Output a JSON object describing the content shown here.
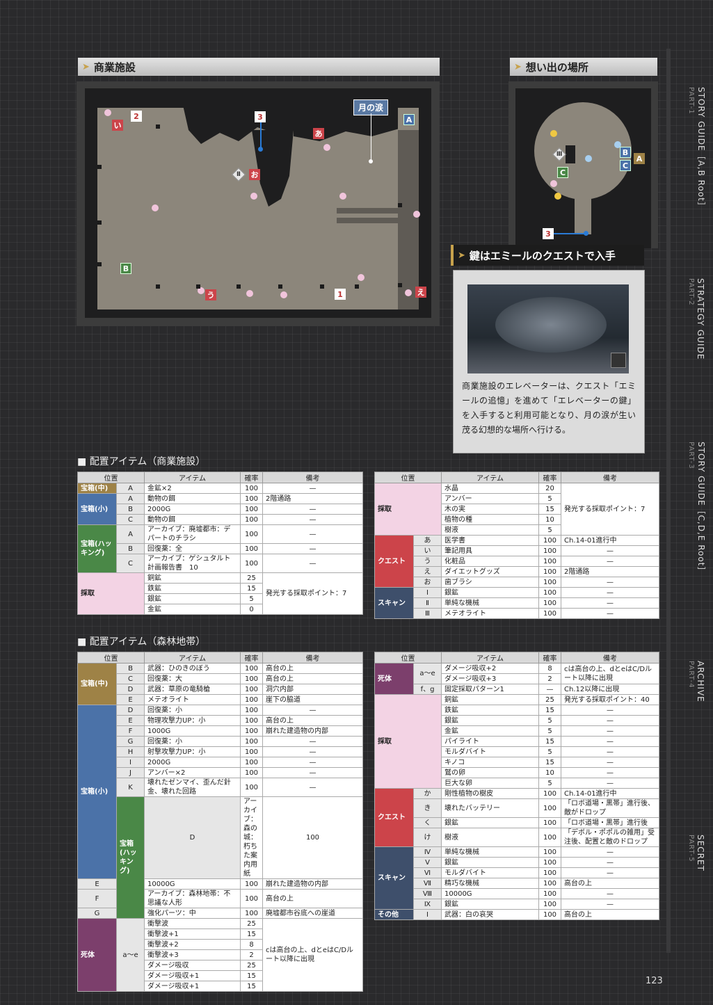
{
  "map1": {
    "title": "商業施設",
    "tag_tears": "月の涙",
    "markers": {
      "i": "い",
      "a": "あ",
      "o": "お",
      "u": "う",
      "e": "え",
      "n1": "1",
      "n2": "2",
      "n3": "3",
      "A": "A",
      "B": "B",
      "II": "Ⅱ"
    }
  },
  "map2": {
    "title": "想い出の場所",
    "markers": {
      "III": "Ⅲ",
      "A": "A",
      "B": "B",
      "C": "C",
      "n3": "3"
    }
  },
  "key": {
    "title": "鍵はエミールのクエストで入手",
    "caption": "商業施設のエレベーターは、クエスト「エミールの追憶」を進めて「エレベーターの鍵」を入手すると利用可能となり、月の涙が生い茂る幻想的な場所へ行ける。"
  },
  "section1": "配置アイテム（商業施設）",
  "section2": "配置アイテム（森林地帯）",
  "headers": {
    "pos": "位置",
    "item": "アイテム",
    "rate": "確率",
    "note": "備考"
  },
  "t1": [
    {
      "cat": "宝箱(中)",
      "cls": "gold",
      "span": 1,
      "sub": "A",
      "item": "金鉱×2",
      "rate": "100",
      "note": "—"
    },
    {
      "cat": "宝箱(小)",
      "cls": "blue",
      "span": 3,
      "sub": "A",
      "item": "動物の餌",
      "rate": "100",
      "note": "2階通路"
    },
    {
      "sub": "B",
      "item": "2000G",
      "rate": "100",
      "note": "—"
    },
    {
      "sub": "C",
      "item": "動物の餌",
      "rate": "100",
      "note": "—"
    },
    {
      "cat": "宝箱(ハッキング)",
      "cls": "green",
      "span": 3,
      "sub": "A",
      "item": "アーカイブ：廃墟都市：デパートのチラシ",
      "rate": "100",
      "note": "—",
      "tall": true
    },
    {
      "sub": "B",
      "item": "回復薬：全",
      "rate": "100",
      "note": "—"
    },
    {
      "sub": "C",
      "item": "アーカイブ：ゲシュタルト計画報告書　10",
      "rate": "100",
      "note": "—",
      "tall": true
    },
    {
      "cat": "採取",
      "cls": "pinkc",
      "span": 4,
      "nosub": true,
      "item": "銅鉱",
      "rate": "25",
      "note": "発光する採取ポイント：7",
      "nspan": 4
    },
    {
      "nosub": true,
      "item": "鉄鉱",
      "rate": "15"
    },
    {
      "nosub": true,
      "item": "銀鉱",
      "rate": "5"
    },
    {
      "nosub": true,
      "item": "金鉱",
      "rate": "0"
    }
  ],
  "t2": [
    {
      "cat": "採取",
      "cls": "pinkc",
      "span": 5,
      "nosub": true,
      "item": "水晶",
      "rate": "20",
      "note": "発光する採取ポイント：7",
      "nspan": 5
    },
    {
      "nosub": true,
      "item": "アンバー",
      "rate": "5"
    },
    {
      "nosub": true,
      "item": "木の実",
      "rate": "15"
    },
    {
      "nosub": true,
      "item": "植物の種",
      "rate": "10"
    },
    {
      "nosub": true,
      "item": "樹液",
      "rate": "5"
    },
    {
      "cat": "クエスト",
      "cls": "red",
      "span": 5,
      "sub": "あ",
      "item": "医学書",
      "rate": "100",
      "note": "Ch.14-01進行中"
    },
    {
      "sub": "い",
      "item": "筆記用具",
      "rate": "100",
      "note": "—"
    },
    {
      "sub": "う",
      "item": "化粧品",
      "rate": "100",
      "note": "—"
    },
    {
      "sub": "え",
      "item": "ダイエットグッズ",
      "rate": "100",
      "note": "2階通路"
    },
    {
      "sub": "お",
      "item": "歯ブラシ",
      "rate": "100",
      "note": "—"
    },
    {
      "cat": "スキャン",
      "cls": "navy",
      "span": 3,
      "sub": "Ⅰ",
      "item": "銀鉱",
      "rate": "100",
      "note": "—"
    },
    {
      "sub": "Ⅱ",
      "item": "単純な機械",
      "rate": "100",
      "note": "—"
    },
    {
      "sub": "Ⅲ",
      "item": "メテオライト",
      "rate": "100",
      "note": "—"
    }
  ],
  "t3": [
    {
      "cat": "宝箱(中)",
      "cls": "gold",
      "span": 4,
      "sub": "B",
      "item": "武器：ひのきのぼう",
      "rate": "100",
      "note": "高台の上"
    },
    {
      "sub": "C",
      "item": "回復薬：大",
      "rate": "100",
      "note": "高台の上"
    },
    {
      "sub": "D",
      "item": "武器：草原の竜騎槍",
      "rate": "100",
      "note": "洞穴内部"
    },
    {
      "sub": "E",
      "item": "メテオライト",
      "rate": "100",
      "note": "崖下の脇道"
    },
    {
      "cat": "宝箱(小)",
      "cls": "blue",
      "span": 9,
      "sub": "D",
      "item": "回復薬：小",
      "rate": "100",
      "note": "—"
    },
    {
      "sub": "E",
      "item": "物理攻撃力UP：小",
      "rate": "100",
      "note": "高台の上"
    },
    {
      "sub": "F",
      "item": "1000G",
      "rate": "100",
      "note": "崩れた建造物の内部"
    },
    {
      "sub": "G",
      "item": "回復薬：小",
      "rate": "100",
      "note": "—"
    },
    {
      "sub": "H",
      "item": "射撃攻撃力UP：小",
      "rate": "100",
      "note": "—"
    },
    {
      "sub": "I",
      "item": "2000G",
      "rate": "100",
      "note": "—"
    },
    {
      "sub": "J",
      "item": "アンバー×2",
      "rate": "100",
      "note": "—"
    },
    {
      "sub": "K",
      "item": "壊れたゼンマイ、歪んだ針金、壊れた回路",
      "rate": "100",
      "note": "—",
      "tall": true
    },
    {
      "cat": "宝箱(ハッキング)",
      "cls": "green",
      "span": 4,
      "sub": "D",
      "item": "アーカイブ：森の城：朽ちた案内用紙",
      "rate": "100",
      "note": "—",
      "tall": true
    },
    {
      "sub": "E",
      "item": "10000G",
      "rate": "100",
      "note": "崩れた建造物の内部"
    },
    {
      "sub": "F",
      "item": "アーカイブ：森林地帯：不思議な人形",
      "rate": "100",
      "note": "高台の上",
      "tall": true
    },
    {
      "sub": "G",
      "item": "強化パーツ：中",
      "rate": "100",
      "note": "廃墟都市谷底への崖道"
    },
    {
      "cat": "死体",
      "cls": "purple",
      "span": 7,
      "sub": "a〜e",
      "subspan": 7,
      "item": "衝撃波",
      "rate": "25",
      "note": "cは高台の上、dとeはC/Dルート以降に出現",
      "nspan": 7
    },
    {
      "item": "衝撃波+1",
      "rate": "15"
    },
    {
      "item": "衝撃波+2",
      "rate": "8"
    },
    {
      "item": "衝撃波+3",
      "rate": "2"
    },
    {
      "item": "ダメージ吸収",
      "rate": "25"
    },
    {
      "item": "ダメージ吸収+1",
      "rate": "15"
    },
    {
      "item": "ダメージ吸収+1",
      "rate": "15"
    }
  ],
  "t4": [
    {
      "cat": "死体",
      "cls": "purple",
      "span": 3,
      "sub": "a〜e",
      "subspan": 2,
      "item": "ダメージ吸収+2",
      "rate": "8",
      "note": "cは高台の上、dとeはC/Dルート以降に出現",
      "nspan": 2
    },
    {
      "item": "ダメージ吸収+3",
      "rate": "2"
    },
    {
      "sub": "f、g",
      "item": "固定採取パターン1",
      "rate": "—",
      "note": "Ch.12以降に出現"
    },
    {
      "cat": "採取",
      "cls": "pinkc",
      "span": 9,
      "nosub": true,
      "item": "銅鉱",
      "rate": "25",
      "note": "発光する採取ポイント：40"
    },
    {
      "nosub": true,
      "item": "鉄鉱",
      "rate": "15",
      "note": "—"
    },
    {
      "nosub": true,
      "item": "銀鉱",
      "rate": "5",
      "note": "—"
    },
    {
      "nosub": true,
      "item": "金鉱",
      "rate": "5",
      "note": "—"
    },
    {
      "nosub": true,
      "item": "パイライト",
      "rate": "15",
      "note": "—"
    },
    {
      "nosub": true,
      "item": "モルダバイト",
      "rate": "5",
      "note": "—"
    },
    {
      "nosub": true,
      "item": "キノコ",
      "rate": "15",
      "note": "—"
    },
    {
      "nosub": true,
      "item": "鷲の卵",
      "rate": "10",
      "note": "—"
    },
    {
      "nosub": true,
      "item": "巨大な卵",
      "rate": "5",
      "note": "—"
    },
    {
      "cat": "クエスト",
      "cls": "red",
      "span": 4,
      "sub": "か",
      "item": "剛性植物の樹皮",
      "rate": "100",
      "note": "Ch.14-01進行中"
    },
    {
      "sub": "き",
      "item": "壊れたバッテリー",
      "rate": "100",
      "note": "「ロボ道場・黒帯」進行後、敵がドロップ",
      "tall": true
    },
    {
      "sub": "く",
      "item": "銀鉱",
      "rate": "100",
      "note": "「ロボ道場・黒帯」進行後"
    },
    {
      "sub": "け",
      "item": "樹液",
      "rate": "100",
      "note": "「デボル・ポポルの雑用」受注後、配置と敵のドロップ",
      "tall": true
    },
    {
      "cat": "スキャン",
      "cls": "navy",
      "span": 6,
      "sub": "Ⅳ",
      "item": "単純な機械",
      "rate": "100",
      "note": "—"
    },
    {
      "sub": "Ⅴ",
      "item": "銀鉱",
      "rate": "100",
      "note": "—"
    },
    {
      "sub": "Ⅵ",
      "item": "モルダバイト",
      "rate": "100",
      "note": "—"
    },
    {
      "sub": "Ⅶ",
      "item": "精巧な機械",
      "rate": "100",
      "note": "高台の上"
    },
    {
      "sub": "Ⅷ",
      "item": "10000G",
      "rate": "100",
      "note": "—"
    },
    {
      "sub": "Ⅸ",
      "item": "銀鉱",
      "rate": "100",
      "note": "—"
    },
    {
      "cat": "その他",
      "cls": "navy",
      "span": 1,
      "sub": "Ⅰ",
      "item": "武器：白の哀哭",
      "rate": "100",
      "note": "高台の上"
    }
  ],
  "side": [
    {
      "t": "STORY GUIDE［A,B Root］",
      "p": "PART-1"
    },
    {
      "t": "STRATEGY GUIDE",
      "p": "PART-2"
    },
    {
      "t": "STORY GUIDE［C,D,E Root］",
      "p": "PART-3"
    },
    {
      "t": "ARCHIVE",
      "p": "PART-4"
    },
    {
      "t": "SECRET",
      "p": "PART-5"
    }
  ],
  "page": "123"
}
